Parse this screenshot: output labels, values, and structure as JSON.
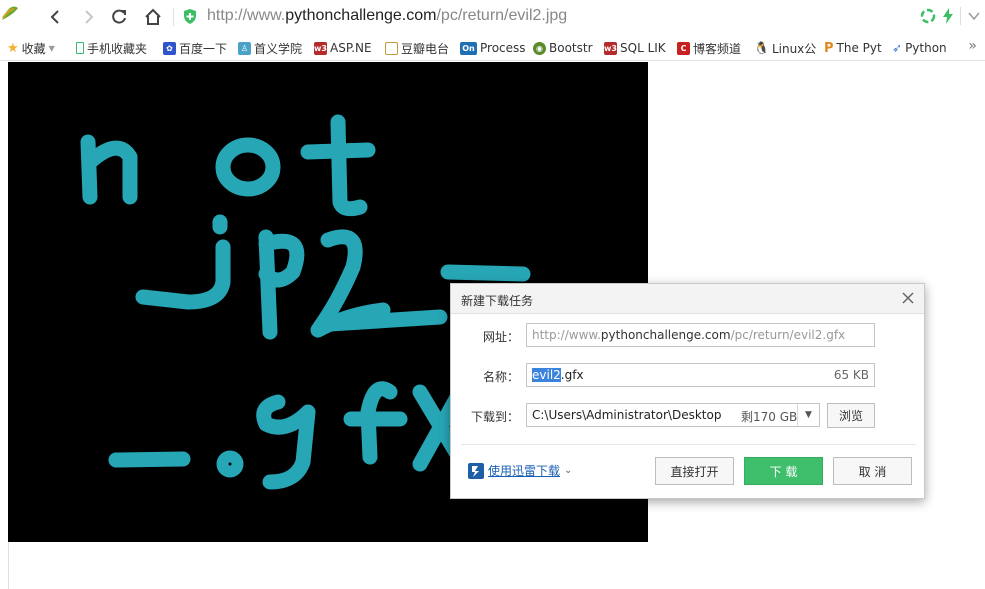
{
  "address_bar": {
    "url_scheme": "http://www.",
    "url_host": "pythonchallenge.com",
    "url_path": "/pc/return/evil2.jpg"
  },
  "bookmarks": [
    {
      "label": "收藏",
      "icon": "star-icon",
      "color": "#f2b02e"
    },
    {
      "label": "手机收藏夹",
      "icon": "phone-icon",
      "color": "#3cb371"
    },
    {
      "label": "百度一下",
      "icon": "baidu-paw-icon",
      "color": "#2f54c9"
    },
    {
      "label": "首义学院",
      "icon": "school-icon",
      "color": "#4aa3c7"
    },
    {
      "label": "ASP.NE",
      "icon": "w3-icon",
      "color": "#b52a2a"
    },
    {
      "label": "豆瓣电台",
      "icon": "douban-icon",
      "color": "#c49a3a"
    },
    {
      "label": "Process",
      "icon": "on-icon",
      "color": "#1f6fb5"
    },
    {
      "label": "Bootstr",
      "icon": "eye-icon",
      "color": "#5a8a2a"
    },
    {
      "label": "SQL LIK",
      "icon": "w3-icon",
      "color": "#b52a2a"
    },
    {
      "label": "博客频道",
      "icon": "c-icon",
      "color": "#c81f1f"
    },
    {
      "label": "Linux公",
      "icon": "linux-icon",
      "color": "#222222"
    },
    {
      "label": "The Pyt",
      "icon": "python-p-icon",
      "color": "#e08a1e"
    },
    {
      "label": "Python",
      "icon": "rocket-icon",
      "color": "#3a7bd5"
    }
  ],
  "dialog": {
    "title": "新建下载任务",
    "url_label": "网址：",
    "url_scheme": "http://www.",
    "url_host": "pythonchallenge.com",
    "url_path": "/pc/return/evil2.gfx",
    "name_label": "名称：",
    "name_selected": "evil2",
    "name_ext": ".gfx",
    "file_size": "65 KB",
    "path_label": "下载到：",
    "path_value": "C:\\Users\\Administrator\\Desktop",
    "free_space": "剩170 GB",
    "browse_label": "浏览",
    "thunder_link": "使用迅雷下载",
    "open_label": "直接打开",
    "download_label": "下 载",
    "cancel_label": "取 消"
  },
  "image": {
    "text_lines": [
      "not",
      "jpg",
      "- .gfx"
    ],
    "stroke_color": "#2ec4d6"
  }
}
